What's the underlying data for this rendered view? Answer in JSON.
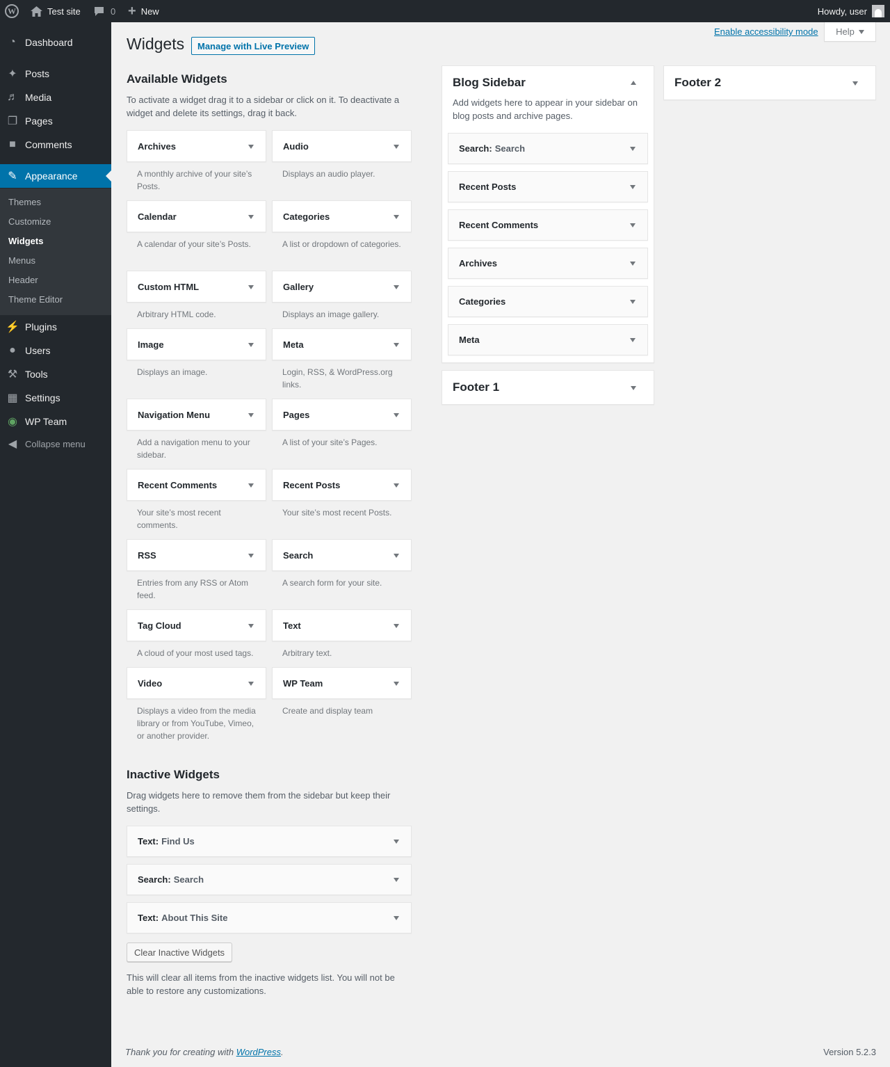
{
  "adminbar": {
    "site_name": "Test site",
    "comments_count": "0",
    "new_label": "New",
    "howdy": "Howdy, user"
  },
  "menu": {
    "dashboard": "Dashboard",
    "posts": "Posts",
    "media": "Media",
    "pages": "Pages",
    "comments": "Comments",
    "appearance": "Appearance",
    "sub": [
      "Themes",
      "Customize",
      "Widgets",
      "Menus",
      "Header",
      "Theme Editor"
    ],
    "plugins": "Plugins",
    "users": "Users",
    "tools": "Tools",
    "settings": "Settings",
    "wpteam": "WP Team",
    "collapse": "Collapse menu"
  },
  "screen_meta": {
    "accessibility": "Enable accessibility mode",
    "help": "Help"
  },
  "header": {
    "title": "Widgets",
    "live_preview": "Manage with Live Preview"
  },
  "available": {
    "title": "Available Widgets",
    "description": "To activate a widget drag it to a sidebar or click on it. To deactivate a widget and delete its settings, drag it back.",
    "widgets": [
      {
        "name": "Archives",
        "desc": "A monthly archive of your site’s Posts."
      },
      {
        "name": "Audio",
        "desc": "Displays an audio player."
      },
      {
        "name": "Calendar",
        "desc": "A calendar of your site’s Posts."
      },
      {
        "name": "Categories",
        "desc": "A list or dropdown of categories."
      },
      {
        "name": "Custom HTML",
        "desc": "Arbitrary HTML code."
      },
      {
        "name": "Gallery",
        "desc": "Displays an image gallery."
      },
      {
        "name": "Image",
        "desc": "Displays an image."
      },
      {
        "name": "Meta",
        "desc": "Login, RSS, & WordPress.org links."
      },
      {
        "name": "Navigation Menu",
        "desc": "Add a navigation menu to your sidebar."
      },
      {
        "name": "Pages",
        "desc": "A list of your site’s Pages."
      },
      {
        "name": "Recent Comments",
        "desc": "Your site’s most recent comments."
      },
      {
        "name": "Recent Posts",
        "desc": "Your site’s most recent Posts."
      },
      {
        "name": "RSS",
        "desc": "Entries from any RSS or Atom feed."
      },
      {
        "name": "Search",
        "desc": "A search form for your site."
      },
      {
        "name": "Tag Cloud",
        "desc": "A cloud of your most used tags."
      },
      {
        "name": "Text",
        "desc": "Arbitrary text."
      },
      {
        "name": "Video",
        "desc": "Displays a video from the media library or from YouTube, Vimeo, or another provider."
      },
      {
        "name": "WP Team",
        "desc": "Create and display team"
      }
    ]
  },
  "inactive": {
    "title": "Inactive Widgets",
    "description": "Drag widgets here to remove them from the sidebar but keep their settings.",
    "widgets": [
      {
        "name": "Text:",
        "sub": "Find Us"
      },
      {
        "name": "Search:",
        "sub": "Search"
      },
      {
        "name": "Text:",
        "sub": "About This Site"
      }
    ],
    "clear_button": "Clear Inactive Widgets",
    "clear_note": "This will clear all items from the inactive widgets list. You will not be able to restore any customizations."
  },
  "blog_sidebar": {
    "title": "Blog Sidebar",
    "description": "Add widgets here to appear in your sidebar on blog posts and archive pages.",
    "widgets": [
      {
        "name": "Search:",
        "sub": "Search"
      },
      {
        "name": "Recent Posts",
        "sub": ""
      },
      {
        "name": "Recent Comments",
        "sub": ""
      },
      {
        "name": "Archives",
        "sub": ""
      },
      {
        "name": "Categories",
        "sub": ""
      },
      {
        "name": "Meta",
        "sub": ""
      }
    ]
  },
  "footer1": {
    "title": "Footer 1"
  },
  "footer2": {
    "title": "Footer 2"
  },
  "footer": {
    "thanks_prefix": "Thank you for creating with ",
    "wordpress": "WordPress",
    "thanks_suffix": ".",
    "version": "Version 5.2.3"
  }
}
